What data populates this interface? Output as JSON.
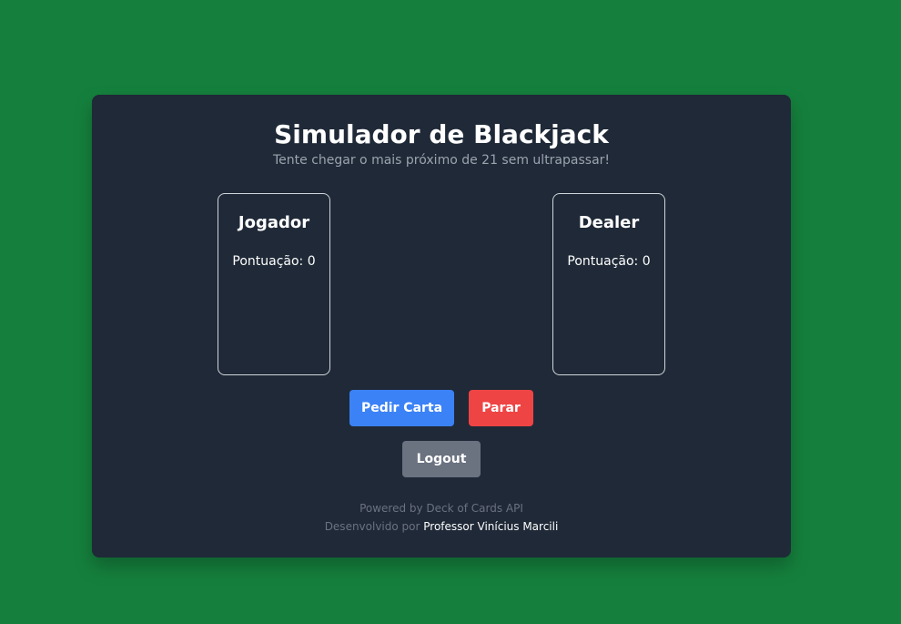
{
  "game": {
    "title": "Simulador de Blackjack",
    "subtitle": "Tente chegar o mais próximo de 21 sem ultrapassar!"
  },
  "player": {
    "title": "Jogador",
    "score_label": "Pontuação: 0"
  },
  "dealer": {
    "title": "Dealer",
    "score_label": "Pontuação: 0"
  },
  "actions": {
    "hit_label": "Pedir Carta",
    "stand_label": "Parar",
    "logout_label": "Logout"
  },
  "footer": {
    "powered_by": "Powered by Deck of Cards API",
    "developed_prefix": "Desenvolvido por",
    "author": "Professor Vinícius Marcili"
  },
  "colors": {
    "background": "#15803d",
    "panel": "#1f2937",
    "hit_button": "#3b82f6",
    "stand_button": "#ef4444",
    "logout_button": "#6b7280"
  }
}
